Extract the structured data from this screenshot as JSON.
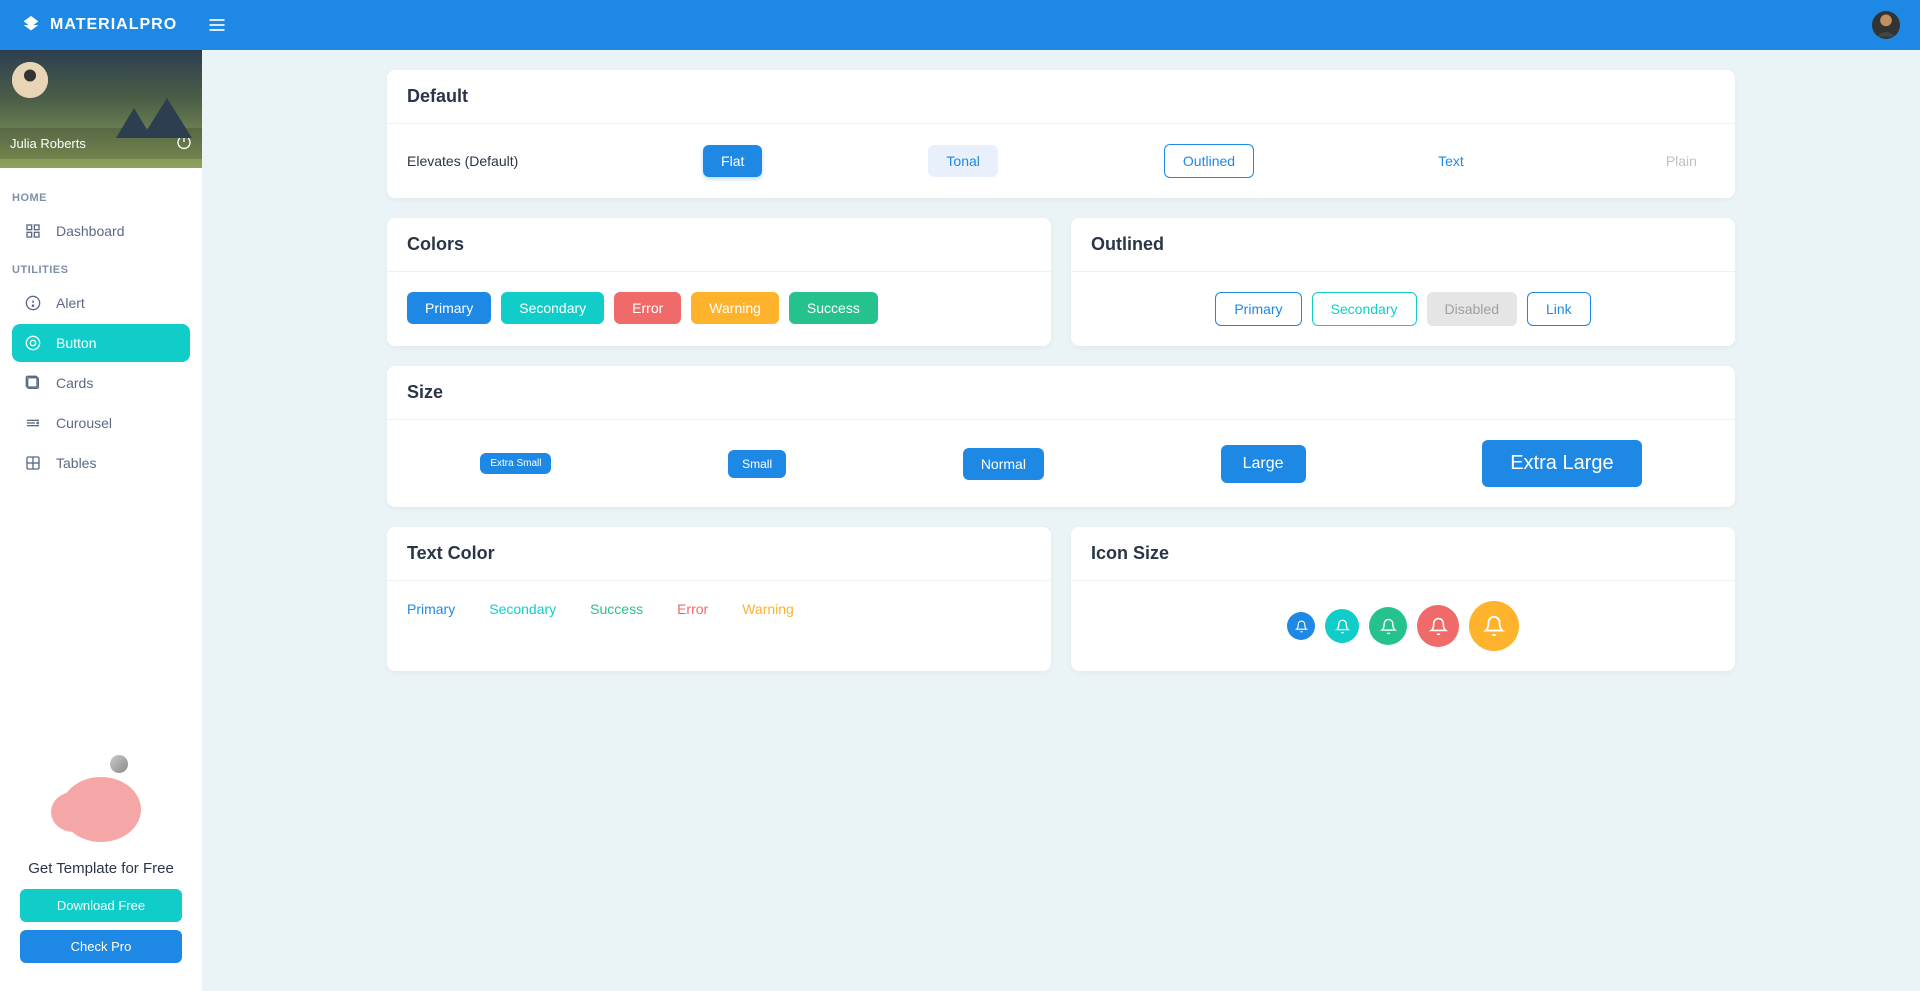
{
  "brand": "MATERIALPRO",
  "user": {
    "name": "Julia Roberts"
  },
  "sidebar": {
    "sections": {
      "home": "HOME",
      "utilities": "UTILITIES"
    },
    "items": {
      "dashboard": "Dashboard",
      "alert": "Alert",
      "button": "Button",
      "cards": "Cards",
      "carousel": "Curousel",
      "tables": "Tables"
    },
    "promo": {
      "title": "Get Template for Free",
      "download": "Download Free",
      "check": "Check Pro"
    }
  },
  "cards": {
    "default": {
      "title": "Default",
      "label": "Elevates (Default)",
      "flat": "Flat",
      "tonal": "Tonal",
      "outlined": "Outlined",
      "text": "Text",
      "plain": "Plain"
    },
    "colors": {
      "title": "Colors",
      "primary": "Primary",
      "secondary": "Secondary",
      "error": "Error",
      "warning": "Warning",
      "success": "Success"
    },
    "outlined": {
      "title": "Outlined",
      "primary": "Primary",
      "secondary": "Secondary",
      "disabled": "Disabled",
      "link": "Link"
    },
    "size": {
      "title": "Size",
      "xs": "Extra Small",
      "sm": "Small",
      "normal": "Normal",
      "lg": "Large",
      "xl": "Extra Large"
    },
    "textcolor": {
      "title": "Text Color",
      "primary": "Primary",
      "secondary": "Secondary",
      "success": "Success",
      "error": "Error",
      "warning": "Warning"
    },
    "iconsize": {
      "title": "Icon Size"
    }
  }
}
